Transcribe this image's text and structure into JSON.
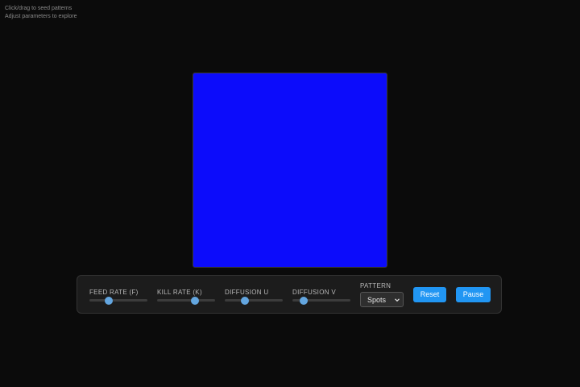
{
  "hint": {
    "line1": "Click/drag to seed patterns",
    "line2": "Adjust parameters to explore"
  },
  "canvas": {
    "fill_color": "#0c0cfb"
  },
  "controls": {
    "sliders": [
      {
        "label": "FEED RATE (F)",
        "value_fraction": 0.33
      },
      {
        "label": "KILL RATE (K)",
        "value_fraction": 0.65
      },
      {
        "label": "DIFFUSION U",
        "value_fraction": 0.35
      },
      {
        "label": "DIFFUSION V",
        "value_fraction": 0.19
      }
    ],
    "pattern": {
      "label": "PATTERN",
      "selected": "Spots",
      "arrow_icon": "chevron-down-icon"
    },
    "reset_label": "Reset",
    "pause_label": "Pause",
    "accent_color": "#2196f3",
    "thumb_color": "#63a6e0"
  }
}
